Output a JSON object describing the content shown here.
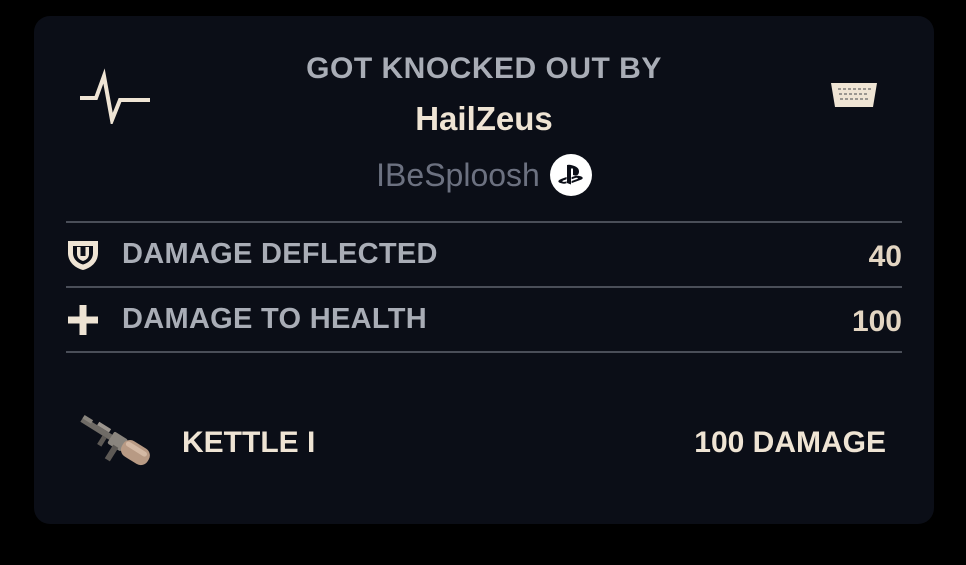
{
  "header": {
    "label": "GOT KNOCKED OUT BY",
    "killer_name": "HailZeus",
    "platform_name": "IBeSploosh",
    "left_icon": "pulse-icon",
    "right_icon": "keyboard-icon",
    "platform_icon": "playstation-icon"
  },
  "stats": [
    {
      "icon": "shield-icon",
      "label": "DAMAGE DEFLECTED",
      "value": "40"
    },
    {
      "icon": "plus-icon",
      "label": "DAMAGE TO HEALTH",
      "value": "100"
    }
  ],
  "weapon": {
    "icon": "weapon-image",
    "name": "KETTLE I",
    "damage": "100 DAMAGE"
  },
  "colors": {
    "background": "#000000",
    "card": "#0b0e17",
    "primary_text": "#efe4d4",
    "secondary_text": "#a9adb6",
    "muted_text": "#6c7180",
    "value_text": "#e3d5c2",
    "divider": "#4a4e58"
  }
}
